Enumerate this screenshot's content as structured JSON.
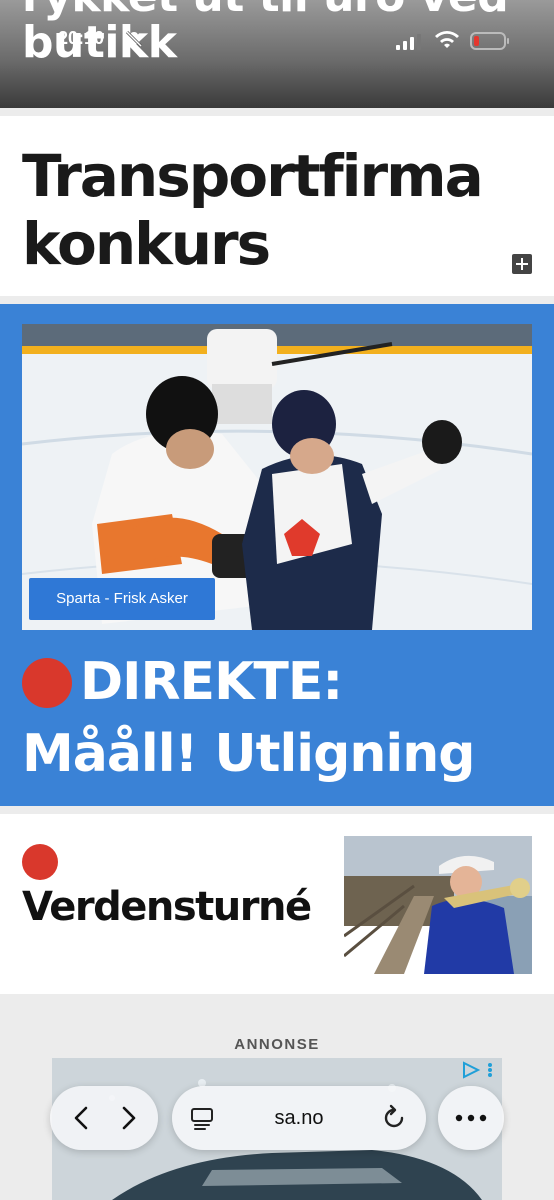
{
  "status_bar": {
    "time": "20:10"
  },
  "feed": {
    "previous_headline": "rykket ut til uro ved butikk",
    "story1": {
      "headline": "Transportfirma konkurs"
    },
    "story2": {
      "image_label": "Sparta - Frisk Asker",
      "headline_line1": "DIREKTE:",
      "headline_line2": "Mååll! Utligning"
    },
    "story3": {
      "headline": "Verdensturné"
    },
    "ad": {
      "label": "ANNONSE"
    }
  },
  "browser": {
    "url": "sa.no"
  },
  "colors": {
    "live_blue": "#3a82d6",
    "live_red": "#d9382c"
  }
}
